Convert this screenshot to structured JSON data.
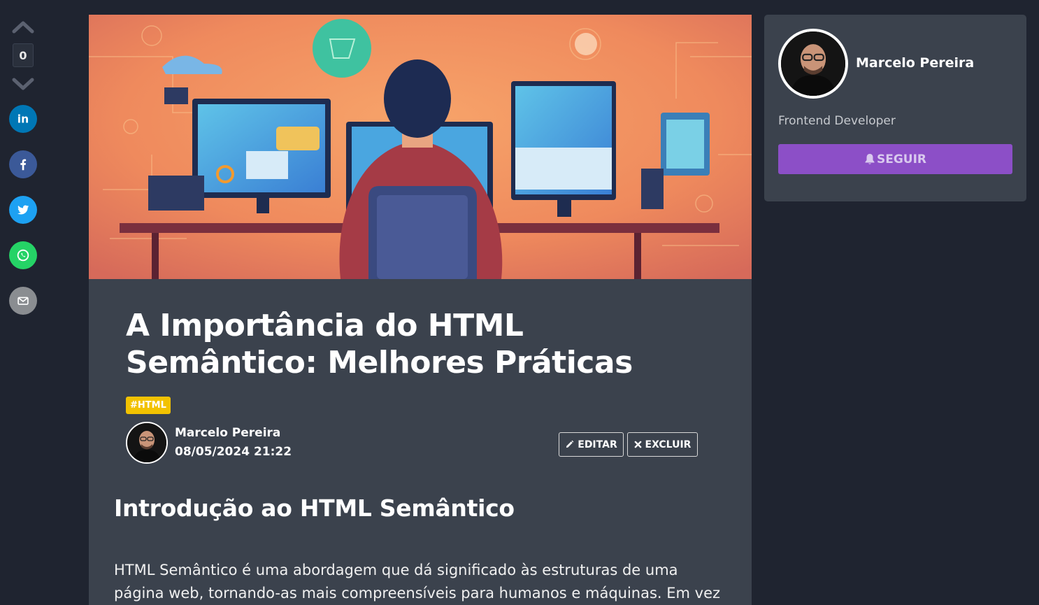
{
  "vote": {
    "count": "0"
  },
  "share": [
    {
      "name": "linkedin",
      "icon": "linkedin-icon",
      "color": "#0077b5"
    },
    {
      "name": "facebook",
      "icon": "facebook-icon",
      "color": "#3b5998"
    },
    {
      "name": "twitter",
      "icon": "twitter-icon",
      "color": "#1da1f2"
    },
    {
      "name": "whatsapp",
      "icon": "whatsapp-icon",
      "color": "#25d366"
    },
    {
      "name": "email",
      "icon": "email-icon",
      "color": "#8a8d91"
    }
  ],
  "article": {
    "title": "A Importância do HTML Semântico: Melhores Práticas",
    "tag": "#HTML",
    "author": {
      "name": "Marcelo Pereira",
      "date": "08/05/2024 21:22"
    },
    "actions": {
      "edit_label": "EDITAR",
      "delete_label": "EXCLUIR"
    },
    "section_heading": "Introdução ao HTML Semântico",
    "paragraph": "HTML Semântico é uma abordagem que dá significado às estruturas de uma página web, tornando-as mais compreensíveis para humanos e máquinas. Em vez de"
  },
  "sidebar": {
    "name": "Marcelo Pereira",
    "role": "Frontend Developer",
    "follow_label": "SEGUIR"
  },
  "colors": {
    "background": "#1f2430",
    "card": "#3b424d",
    "tag": "#f2c200",
    "follow": "#8c4fc7"
  }
}
